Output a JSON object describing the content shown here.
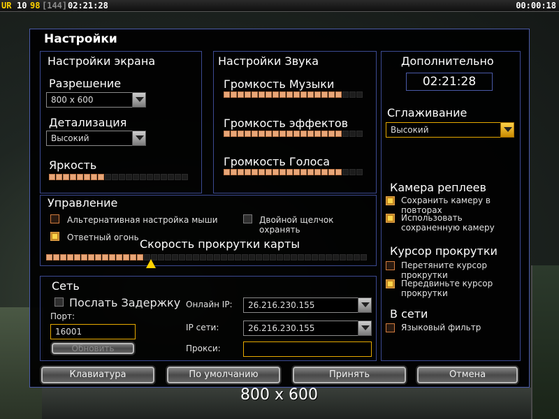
{
  "hud": {
    "ur": "UR",
    "n1": "10",
    "n2": "98",
    "n3": "[144]",
    "clock": "02:21:28",
    "timer": "00:00:18"
  },
  "dialog": {
    "title": "Настройки"
  },
  "screen": {
    "title": "Настройки экрана",
    "resolution_label": "Разрешение",
    "resolution_value": "800 x 600",
    "detail_label": "Детализация",
    "detail_value": "Высокий",
    "brightness_label": "Яркость",
    "brightness_level": 8,
    "brightness_total": 20
  },
  "sound": {
    "title": "Настройки Звука",
    "music_label": "Громкость Музыки",
    "music_level": 17,
    "effects_label": "Громкость эффектов",
    "effects_level": 17,
    "voice_label": "Громкость Голоса",
    "voice_level": 17,
    "total": 20
  },
  "extra": {
    "title": "Дополнительно",
    "time": "02:21:28",
    "aa_label": "Сглаживание",
    "aa_value": "Высокий",
    "replay_camera_label": "Камера реплеев",
    "save_camera": "Сохранить камеру в повторах",
    "use_saved_camera": "Использовать сохраненную камеру",
    "scroll_cursor_label": "Курсор прокрутки",
    "drag_cursor": "Перетяните курсор прокрутки",
    "move_cursor": "Передвиньте курсор прокрутки",
    "online_label": "В сети",
    "language_filter": "Языковый фильтр"
  },
  "control": {
    "title": "Управление",
    "alt_mouse": "Альтернативная настройка мыши",
    "double_click": "Двойной щелчок охранять",
    "return_fire": "Ответный огонь",
    "scroll_speed_label": "Скорость прокрутки карты",
    "scroll_speed_level": 14,
    "scroll_speed_total": 46
  },
  "network": {
    "title": "Сеть",
    "send_delay": "Послать Задержку",
    "port_label": "Порт:",
    "port_value": "16001",
    "refresh": "Обновить",
    "online_ip_label": "Онлайн IP:",
    "online_ip_value": "26.216.230.155",
    "lan_ip_label": "IP сети:",
    "lan_ip_value": "26.216.230.155",
    "proxy_label": "Прокси:",
    "proxy_value": ""
  },
  "buttons": {
    "keyboard": "Клавиатура",
    "defaults": "По умолчанию",
    "accept": "Принять",
    "cancel": "Отмена"
  },
  "footer": {
    "resolution_text": "800 x 600"
  }
}
